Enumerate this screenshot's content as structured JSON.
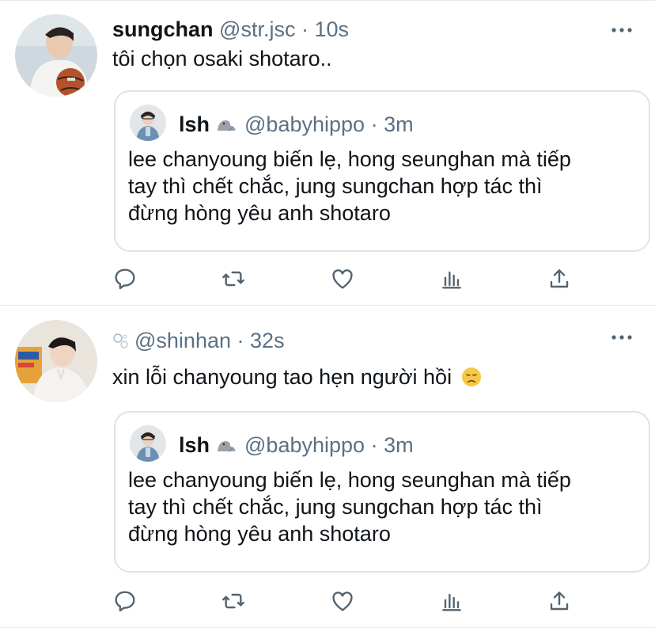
{
  "tweets": [
    {
      "name": "sungchan",
      "handle": "@str.jsc",
      "separator": "·",
      "time": "10s",
      "text": "tôi chọn osaki shotaro..",
      "quote": {
        "name": "lsh",
        "name_emoji": "seal",
        "handle": "@babyhippo",
        "separator": "·",
        "time": "3m",
        "lines": [
          "lee chanyoung biến lẹ, hong seunghan mà tiếp",
          "tay thì chết chắc, jung sungchan hợp tác thì",
          "đừng hòng yêu anh shotaro"
        ]
      }
    },
    {
      "name": "",
      "name_emoji": "bubbles",
      "handle": "@shinhan",
      "separator": "·",
      "time": "32s",
      "text": "xin lỗi chanyoung tao hẹn người hồi",
      "text_emoji": "disappointed-face",
      "quote": {
        "name": "lsh",
        "name_emoji": "seal",
        "handle": "@babyhippo",
        "separator": "·",
        "time": "3m",
        "lines": [
          "lee chanyoung biến lẹ, hong seunghan mà tiếp",
          "tay thì chết chắc, jung sungchan hợp tác thì",
          "đừng hòng yêu anh shotaro"
        ]
      }
    }
  ],
  "icons": {
    "actions": [
      "reply-icon",
      "retweet-icon",
      "like-icon",
      "analytics-icon",
      "share-icon"
    ],
    "menu": "more-icon"
  },
  "colors": {
    "text": "#0f1419",
    "secondary": "#5b7083",
    "border": "#dfe3e6",
    "icon": "#536471"
  }
}
